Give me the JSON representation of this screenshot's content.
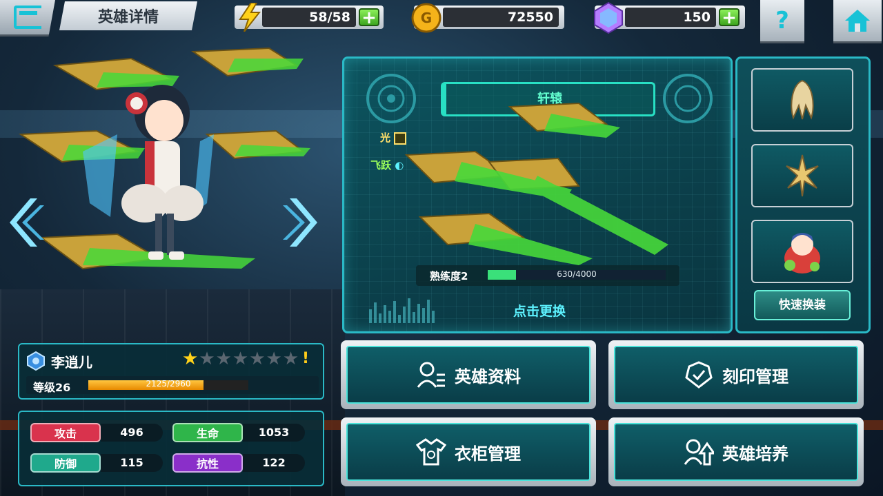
{
  "topbar": {
    "title": "英雄详情",
    "energy": "58/58",
    "gold": "72550",
    "gems": "150",
    "help": "?"
  },
  "weapon": {
    "name": "轩辕",
    "attr_light": "光",
    "attr_fly": "飞跃",
    "proficiency_label": "熟练度2",
    "proficiency_value": "630/4000",
    "proficiency_fraction": 0.1575,
    "replace_link": "点击更换"
  },
  "slots": {
    "quick_equip": "快速换装"
  },
  "hero": {
    "name": "李逍儿",
    "stars_filled": 1,
    "stars_total": 7,
    "warning": "!",
    "level_label": "等级26",
    "exp_value": "2125/2960",
    "exp_fraction": 0.718
  },
  "stats": [
    {
      "label": "攻击",
      "value": "496",
      "color": "#d9334d"
    },
    {
      "label": "生命",
      "value": "1053",
      "color": "#2fb54a"
    },
    {
      "label": "防御",
      "value": "115",
      "color": "#1fa98c"
    },
    {
      "label": "抗性",
      "value": "122",
      "color": "#8a2fc9"
    }
  ],
  "menu": {
    "hero_info": "英雄资料",
    "seal_manage": "刻印管理",
    "wardrobe": "衣柜管理",
    "hero_train": "英雄培养"
  },
  "colors": {
    "accent": "#2ab9c6",
    "gold": "#f5b31a",
    "energy": "#ffd21a",
    "gem": "#b57cff"
  }
}
